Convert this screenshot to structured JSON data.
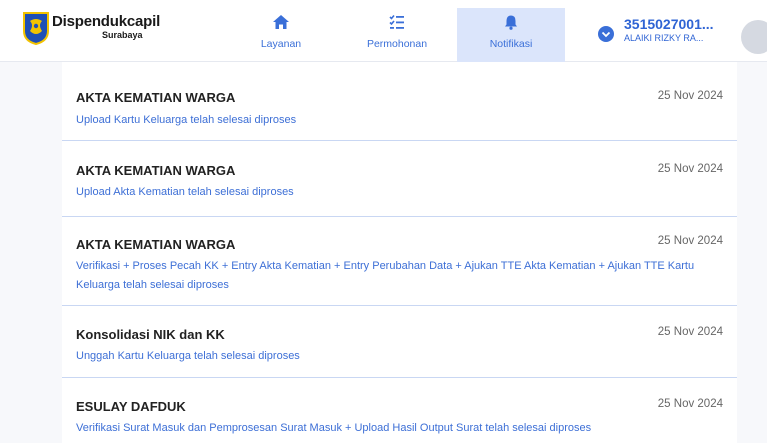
{
  "brand": {
    "name": "Dispendukcapil",
    "city": "Surabaya"
  },
  "nav": {
    "tabs": [
      {
        "label": "Layanan",
        "icon": "home-icon"
      },
      {
        "label": "Permohonan",
        "icon": "checklist-icon"
      },
      {
        "label": "Notifikasi",
        "icon": "bell-icon",
        "active": true
      }
    ]
  },
  "user": {
    "nik": "3515027001...",
    "name": "ALAIKI RIZKY RA..."
  },
  "colors": {
    "accent": "#3a6fd8",
    "active_tab_bg": "#dbe5fb",
    "title": "#222222"
  },
  "notifications": [
    {
      "title": "AKTA KEMATIAN WARGA",
      "date": "25 Nov 2024",
      "message": "Upload Kartu Keluarga telah selesai diproses"
    },
    {
      "title": "AKTA KEMATIAN WARGA",
      "date": "25 Nov 2024",
      "message": "Upload Akta Kematian telah selesai diproses"
    },
    {
      "title": "AKTA KEMATIAN WARGA",
      "date": "25 Nov 2024",
      "message": "Verifikasi + Proses Pecah KK + Entry Akta Kematian + Entry Perubahan Data + Ajukan TTE Akta Kematian + Ajukan TTE Kartu Keluarga telah selesai diproses"
    },
    {
      "title": "Konsolidasi NIK dan KK",
      "date": "25 Nov 2024",
      "message": "Unggah Kartu Keluarga telah selesai diproses"
    },
    {
      "title": "ESULAY DAFDUK",
      "date": "25 Nov 2024",
      "message": "Verifikasi Surat Masuk dan Pemprosesan Surat Masuk + Upload Hasil Output Surat telah selesai diproses"
    }
  ]
}
